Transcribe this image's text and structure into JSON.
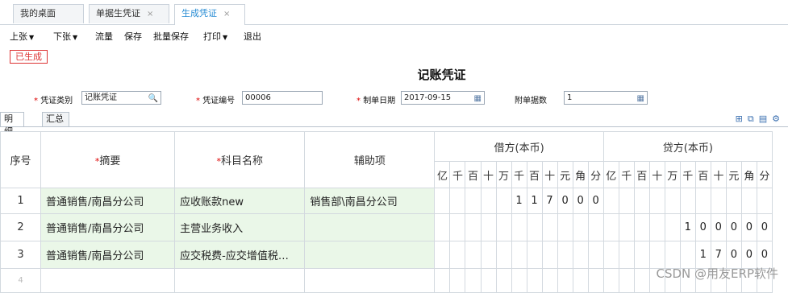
{
  "tabs": [
    {
      "label": "我的桌面"
    },
    {
      "label": "单据生凭证"
    },
    {
      "label": "生成凭证"
    }
  ],
  "close_glyph": "×",
  "toolbar": {
    "prev": "上张",
    "next": "下张",
    "flow": "流量",
    "save": "保存",
    "batch_save": "批量保存",
    "print": "打印",
    "exit": "退出"
  },
  "status_badge": "已生成",
  "voucher_title": "记账凭证",
  "form": {
    "type_label": "凭证类别",
    "type_value": "记账凭证",
    "no_label": "凭证编号",
    "no_value": "00006",
    "date_label": "制单日期",
    "date_value": "2017-09-15",
    "attach_label": "附单据数",
    "attach_value": "1"
  },
  "subtabs": [
    "明细",
    "汇总"
  ],
  "grid": {
    "headers": {
      "seq": "序号",
      "summary": "摘要",
      "account": "科目名称",
      "aux": "辅助项",
      "debit": "借方(本币)",
      "credit": "贷方(本币)"
    },
    "digits": [
      "亿",
      "千",
      "百",
      "十",
      "万",
      "千",
      "百",
      "十",
      "元",
      "角",
      "分"
    ],
    "rows": [
      {
        "seq": "1",
        "summary": "普通销售/南昌分公司",
        "account": "应收账款new",
        "aux": "销售部\\南昌分公司",
        "debit": [
          "",
          "",
          "",
          "",
          "",
          "1",
          "1",
          "7",
          "0",
          "0",
          "0"
        ],
        "credit": [
          "",
          "",
          "",
          "",
          "",
          "",
          "",
          "",
          "",
          "",
          ""
        ]
      },
      {
        "seq": "2",
        "summary": "普通销售/南昌分公司",
        "account": "主营业务收入",
        "aux": "",
        "debit": [
          "",
          "",
          "",
          "",
          "",
          "",
          "",
          "",
          "",
          "",
          ""
        ],
        "credit": [
          "",
          "",
          "",
          "",
          "",
          "1",
          "0",
          "0",
          "0",
          "0",
          "0"
        ]
      },
      {
        "seq": "3",
        "summary": "普通销售/南昌分公司",
        "account": "应交税费-应交增值税…",
        "aux": "",
        "debit": [
          "",
          "",
          "",
          "",
          "",
          "",
          "",
          "",
          "",
          "",
          ""
        ],
        "credit": [
          "",
          "",
          "",
          "",
          "",
          "",
          "1",
          "7",
          "0",
          "0",
          "0"
        ]
      },
      {
        "seq": "4",
        "summary": "",
        "account": "",
        "aux": "",
        "debit": [
          "",
          "",
          "",
          "",
          "",
          "",
          "",
          "",
          "",
          "",
          ""
        ],
        "credit": [
          "",
          "",
          "",
          "",
          "",
          "",
          "",
          "",
          "",
          "",
          ""
        ]
      }
    ]
  },
  "watermark": "CSDN @用友ERP软件"
}
